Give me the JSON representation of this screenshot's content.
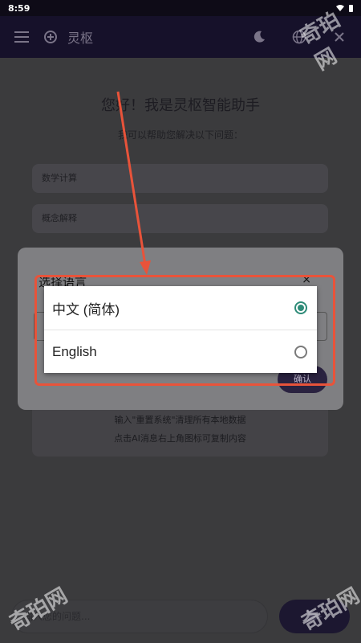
{
  "status_bar": {
    "time": "8:59"
  },
  "app_bar": {
    "title": "灵枢",
    "icons": [
      "menu-icon",
      "add-chat-icon",
      "moon-icon",
      "globe-icon",
      "more-icon"
    ]
  },
  "main": {
    "welcome": "您好！我是灵枢智能助手",
    "subtitle": "我可以帮助您解决以下问题：",
    "chips": [
      "数学计算",
      "概念解释"
    ],
    "tips": [
      "输入\"重置系统\"清理所有本地数据",
      "点击AI消息右上角图标可复制内容"
    ],
    "input_placeholder": "输入您的问题..."
  },
  "dialog": {
    "title": "选择语言",
    "close": "×",
    "confirm_label": "确认"
  },
  "language_menu": {
    "options": [
      {
        "label": "中文 (简体)",
        "selected": true
      },
      {
        "label": "English",
        "selected": false
      }
    ]
  },
  "watermark": "奇珀网",
  "colors": {
    "accent": "#2e8b78",
    "annotation": "#e8533a",
    "app_bar": "#16112a"
  }
}
